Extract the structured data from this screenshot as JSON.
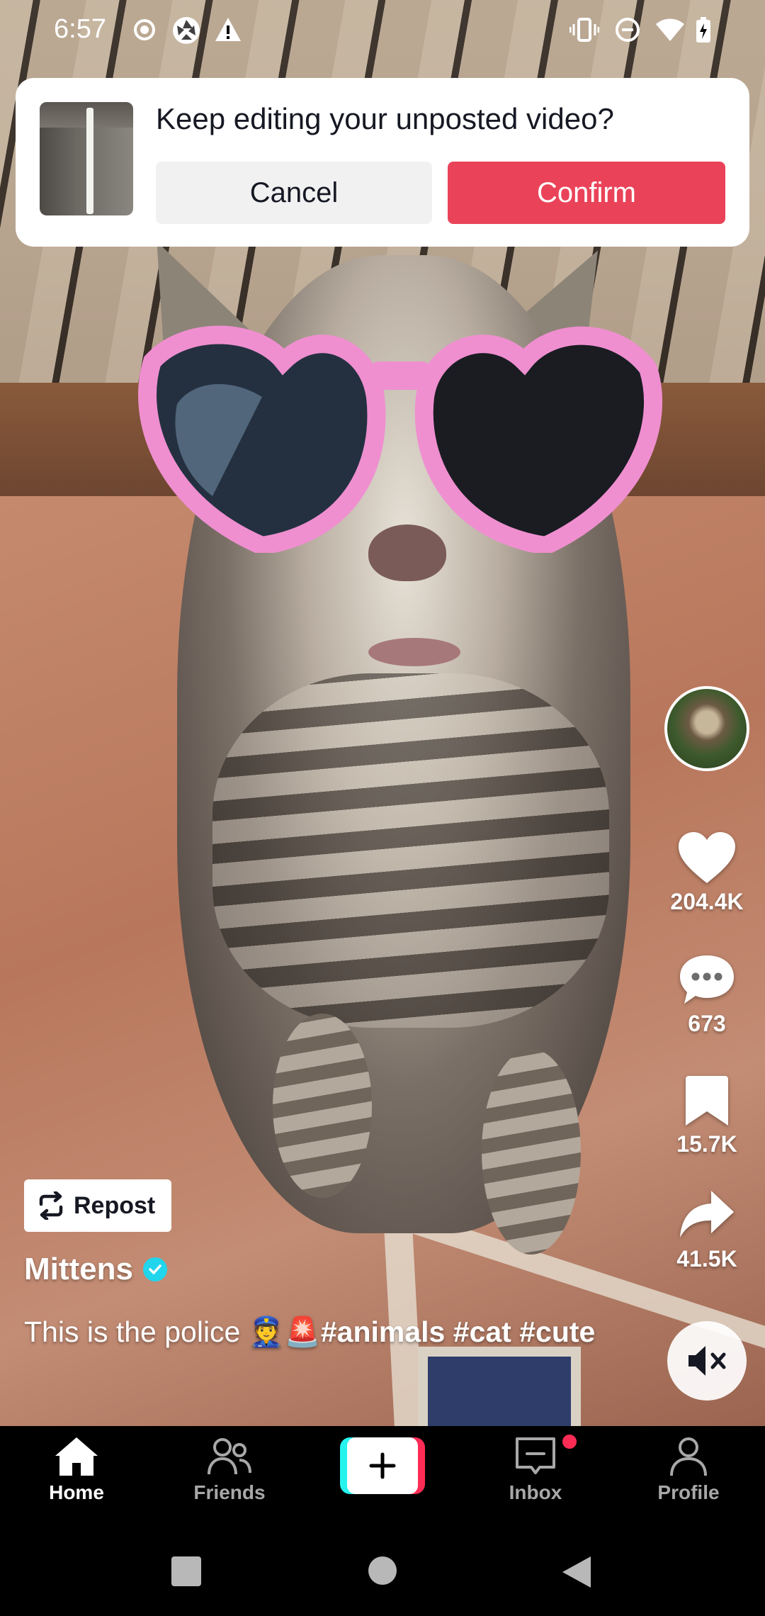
{
  "status_bar": {
    "time": "6:57",
    "left_icons": [
      "record-icon",
      "aperture-icon",
      "warning-icon"
    ],
    "right_icons": [
      "vibrate-icon",
      "do-not-disturb-icon",
      "wifi-icon",
      "battery-charging-icon"
    ]
  },
  "dialog": {
    "title": "Keep editing your unposted video?",
    "cancel_label": "Cancel",
    "confirm_label": "Confirm",
    "confirm_color": "#EA4359"
  },
  "actions": {
    "likes": "204.4K",
    "comments": "673",
    "bookmarks": "15.7K",
    "shares": "41.5K"
  },
  "repost_label": "Repost",
  "author": {
    "name": "Mittens",
    "verified": true
  },
  "caption": {
    "text": "This is the police 👮🚨",
    "hashtags": [
      "#animals",
      "#cat",
      "#cute"
    ]
  },
  "tab_bar": {
    "items": [
      {
        "label": "Home",
        "icon": "home-icon",
        "active": true
      },
      {
        "label": "Friends",
        "icon": "friends-icon",
        "active": false
      },
      {
        "label": "",
        "icon": "create-icon",
        "active": false
      },
      {
        "label": "Inbox",
        "icon": "inbox-icon",
        "active": false,
        "badge": true
      },
      {
        "label": "Profile",
        "icon": "profile-icon",
        "active": false
      }
    ]
  },
  "colors": {
    "accent": "#FE2C55",
    "accent_secondary": "#25F4EE",
    "verified": "#20D5EC"
  }
}
